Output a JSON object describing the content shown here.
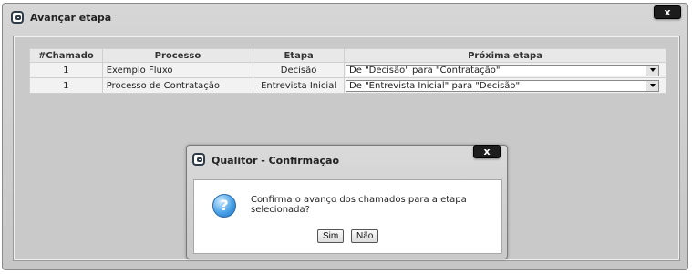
{
  "window": {
    "title": "Avançar etapa",
    "close_label": "x"
  },
  "table": {
    "headers": [
      "#Chamado",
      "Processo",
      "Etapa",
      "Próxima etapa"
    ],
    "rows": [
      {
        "chamado": "1",
        "processo": "Exemplo Fluxo",
        "etapa": "Decisão",
        "proxima": "De \"Decisão\" para \"Contratação\""
      },
      {
        "chamado": "1",
        "processo": "Processo de Contratação",
        "etapa": "Entrevista Inicial",
        "proxima": "De \"Entrevista Inicial\" para \"Decisão\""
      }
    ]
  },
  "dialog": {
    "title": "Qualitor - Confirmação",
    "close_label": "x",
    "icon": "question-icon",
    "icon_glyph": "?",
    "message": "Confirma o avanço dos chamados para a etapa selecionada?",
    "yes_label": "Sim",
    "no_label": "Não"
  }
}
